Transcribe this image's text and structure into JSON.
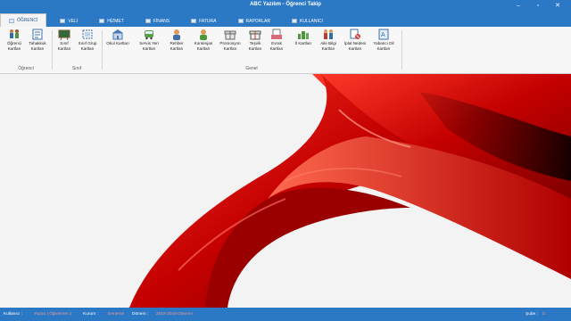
{
  "window": {
    "title": "ABC Yazılım - Öğrenci Takip",
    "minimize": "–",
    "maximize": "▫",
    "close": "✕"
  },
  "tabs": [
    {
      "label": "ÖĞRENCİ",
      "active": true
    },
    {
      "label": "VELİ"
    },
    {
      "label": "HİZMET"
    },
    {
      "label": "FİNANS"
    },
    {
      "label": "FATURA"
    },
    {
      "label": "RAPORLAR"
    },
    {
      "label": "KULLANICI"
    }
  ],
  "ribbon": {
    "groups": {
      "ogrenci": "Öğrenci",
      "sinif": "Sınıf",
      "genel": "Genel"
    },
    "items": [
      {
        "l1": "Öğrenci",
        "l2": "Kartları",
        "icon": "students-icon"
      },
      {
        "l1": "Tahakkuk",
        "l2": "Kartları",
        "icon": "accrual-document-icon"
      },
      {
        "l1": "Sınıf",
        "l2": "Kartları",
        "icon": "blackboard-icon"
      },
      {
        "l1": "Sınıf Grup",
        "l2": "Kartları",
        "icon": "group-select-icon"
      },
      {
        "l1": "Okul Kartları",
        "l2": "",
        "icon": "school-building-icon"
      },
      {
        "l1": "Servis Yeri",
        "l2": "Kartları",
        "icon": "bus-icon"
      },
      {
        "l1": "Rehber",
        "l2": "Kartları",
        "icon": "advisor-person-icon"
      },
      {
        "l1": "Kontenjan",
        "l2": "Kartları",
        "icon": "quota-person-icon"
      },
      {
        "l1": "Promosyon",
        "l2": "Kartları",
        "icon": "gift-icon"
      },
      {
        "l1": "Teşvik",
        "l2": "Kartları",
        "icon": "incentive-gift-icon"
      },
      {
        "l1": "Evrak",
        "l2": "Kartları",
        "icon": "document-tray-icon"
      },
      {
        "l1": "İl Kartları",
        "l2": "",
        "icon": "city-map-icon"
      },
      {
        "l1": "Aile Bilgi",
        "l2": "Kartları",
        "icon": "family-icon"
      },
      {
        "l1": "İptal Nedeni",
        "l2": "Kartları",
        "icon": "cancel-reason-icon"
      },
      {
        "l1": "Yabancı Dil",
        "l2": "Kartları",
        "icon": "language-icon"
      }
    ]
  },
  "status": {
    "user_label": "Kullanıcı :",
    "user_value": "Yazan | Öğretmen 2",
    "course_label": "Kurum :",
    "course_value": "Deneme",
    "period_label": "Dönem :",
    "period_value": "2018-2019 Dönemi",
    "branch_label": "Şube :",
    "branch_value": "Ü"
  }
}
